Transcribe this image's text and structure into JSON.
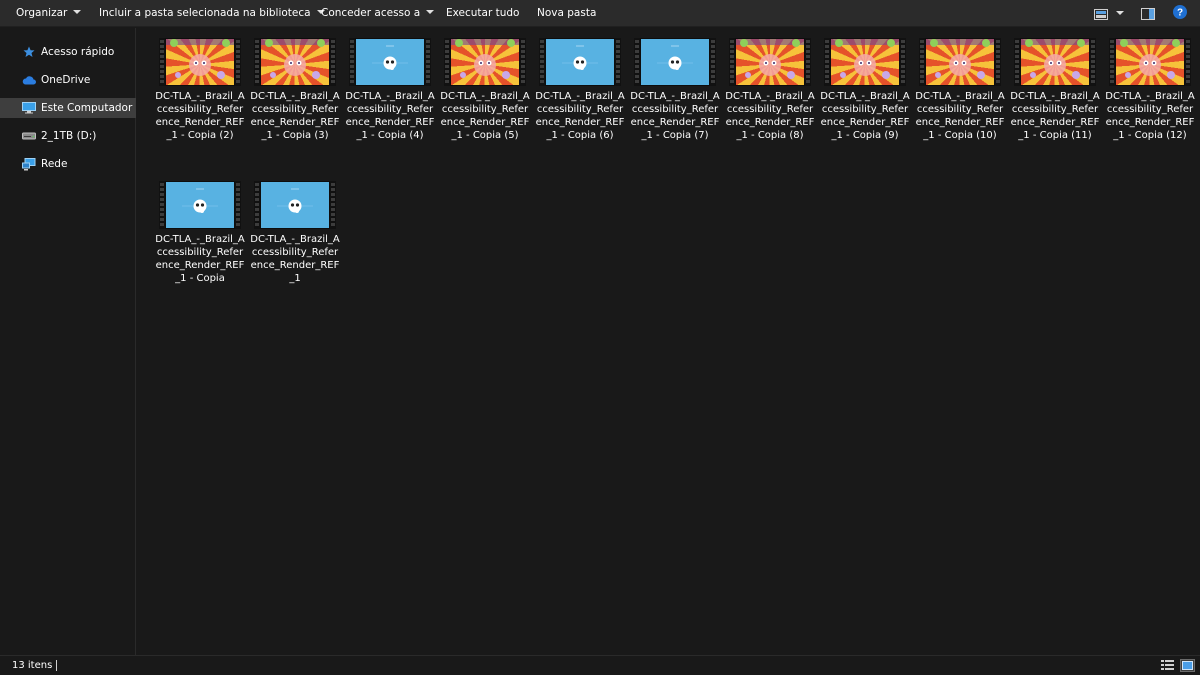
{
  "toolbar": {
    "organize": "Organizar",
    "include_library": "Incluir a pasta selecionada na biblioteca",
    "share_with": "Conceder acesso a",
    "play_all": "Executar tudo",
    "new_folder": "Nova pasta"
  },
  "sidebar": {
    "items": [
      {
        "label": "Acesso rápido",
        "icon": "star-icon"
      },
      {
        "label": "OneDrive",
        "icon": "cloud-icon"
      },
      {
        "label": "Este Computador",
        "icon": "monitor-icon"
      },
      {
        "label": "2_1TB (D:)",
        "icon": "drive-icon"
      },
      {
        "label": "Rede",
        "icon": "network-icon"
      }
    ],
    "selected_index": 2
  },
  "files": [
    {
      "name": "DC-TLA_-_Brazil_Accessibility_Reference_Render_REF_1 - Copia (2)",
      "thumb": "swirl"
    },
    {
      "name": "DC-TLA_-_Brazil_Accessibility_Reference_Render_REF_1 - Copia (3)",
      "thumb": "swirl"
    },
    {
      "name": "DC-TLA_-_Brazil_Accessibility_Reference_Render_REF_1 - Copia (4)",
      "thumb": "blue"
    },
    {
      "name": "DC-TLA_-_Brazil_Accessibility_Reference_Render_REF_1 - Copia (5)",
      "thumb": "swirl"
    },
    {
      "name": "DC-TLA_-_Brazil_Accessibility_Reference_Render_REF_1 - Copia (6)",
      "thumb": "blue"
    },
    {
      "name": "DC-TLA_-_Brazil_Accessibility_Reference_Render_REF_1 - Copia (7)",
      "thumb": "blue"
    },
    {
      "name": "DC-TLA_-_Brazil_Accessibility_Reference_Render_REF_1 - Copia (8)",
      "thumb": "swirl"
    },
    {
      "name": "DC-TLA_-_Brazil_Accessibility_Reference_Render_REF_1 - Copia (9)",
      "thumb": "swirl"
    },
    {
      "name": "DC-TLA_-_Brazil_Accessibility_Reference_Render_REF_1 - Copia (10)",
      "thumb": "swirl"
    },
    {
      "name": "DC-TLA_-_Brazil_Accessibility_Reference_Render_REF_1 - Copia (11)",
      "thumb": "swirl"
    },
    {
      "name": "DC-TLA_-_Brazil_Accessibility_Reference_Render_REF_1 - Copia (12)",
      "thumb": "swirl"
    },
    {
      "name": "DC-TLA_-_Brazil_Accessibility_Reference_Render_REF_1 - Copia",
      "thumb": "blue"
    },
    {
      "name": "DC-TLA_-_Brazil_Accessibility_Reference_Render_REF_1",
      "thumb": "blue"
    }
  ],
  "status": {
    "item_count": "13 itens"
  },
  "colors": {
    "background": "#191919",
    "toolbar": "#2b2b2b",
    "selected_nav": "#3e3e3e",
    "accent_blue": "#0078d7",
    "thumb_blue": "#58b2e2"
  }
}
